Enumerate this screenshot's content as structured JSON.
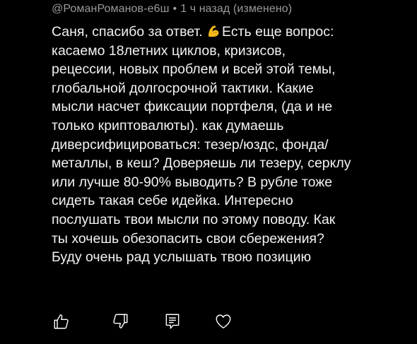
{
  "comment": {
    "author": "@РоманРоманов-е6ш",
    "time": "1 ч назад",
    "edited": "(изменено)",
    "emoji": "flexed-biceps",
    "lines": [
      "Саня, спасибо за ответ. ",
      "Есть еще вопрос:",
      "касаемо 18летних циклов, кризисов,",
      "рецессии, новых проблем и всей этой темы,",
      "глобальной долгосрочной тактики. Какие",
      "мысли насчет фиксации портфеля, (да и не",
      "только криптовалюты). как думаешь",
      "диверсифицироваться:  тезер/юздс, фонда/",
      "металлы, в кеш? Доверяешь ли тезеру, серклу",
      "или лучше 80-90% выводить? В рубле тоже",
      "сидеть такая себе идейка. Интересно",
      "послушать твои мысли по этому поводу. Как",
      "ты хочешь обезопасить свои сбережения?",
      "Буду очень рад услышать твою позицию"
    ]
  },
  "actions": {
    "like_icon": "thumbs-up-icon",
    "dislike_icon": "thumbs-down-icon",
    "reply_icon": "reply-comment-icon",
    "heart_icon": "heart-icon"
  }
}
